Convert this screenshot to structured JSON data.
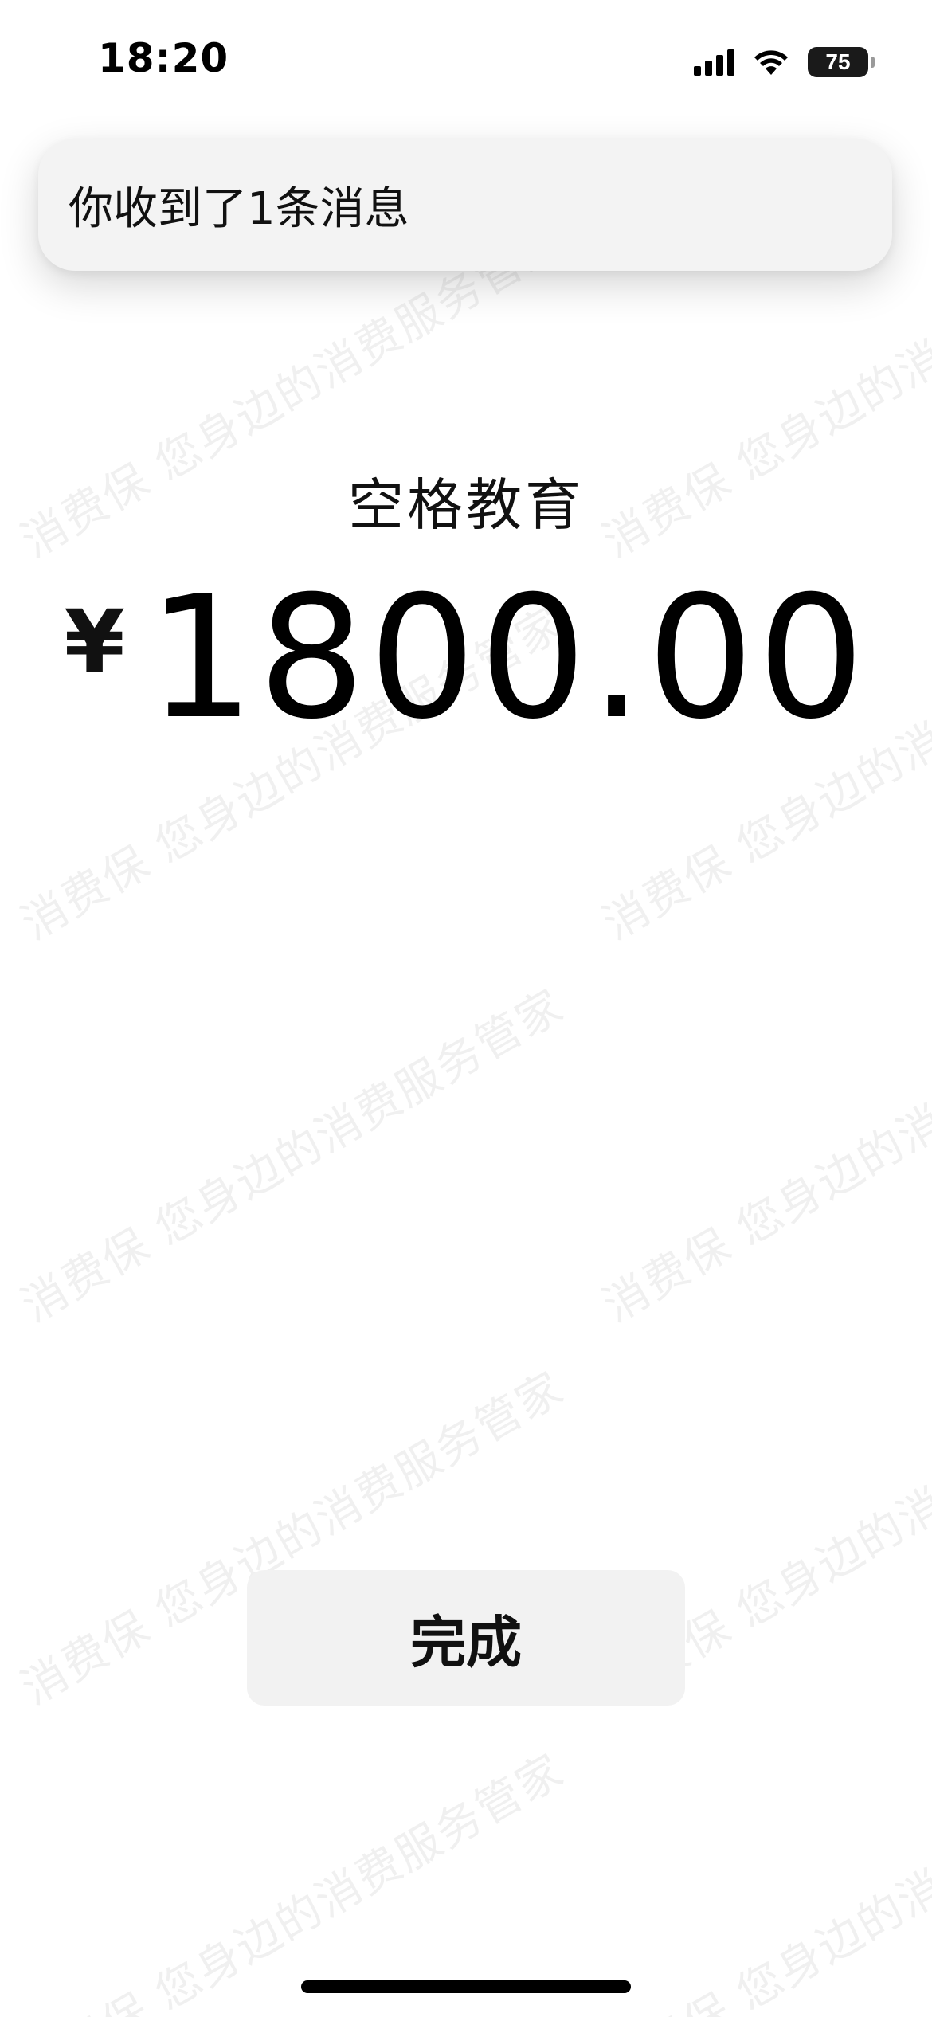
{
  "status_bar": {
    "time": "18:20",
    "battery_level": "75",
    "signal_icon": "cellular-signal-icon",
    "wifi_icon": "wifi-icon"
  },
  "notification": {
    "text": "你收到了1条消息"
  },
  "payment": {
    "payee": "空格教育",
    "currency_symbol": "¥",
    "amount": "1800.00"
  },
  "actions": {
    "done_label": "完成"
  },
  "watermark": {
    "text": "消费保 您身边的消费服务管家"
  },
  "colors": {
    "background": "#ffffff",
    "button_bg": "#f2f2f2",
    "banner_bg": "#f3f3f3",
    "text": "#111111"
  }
}
